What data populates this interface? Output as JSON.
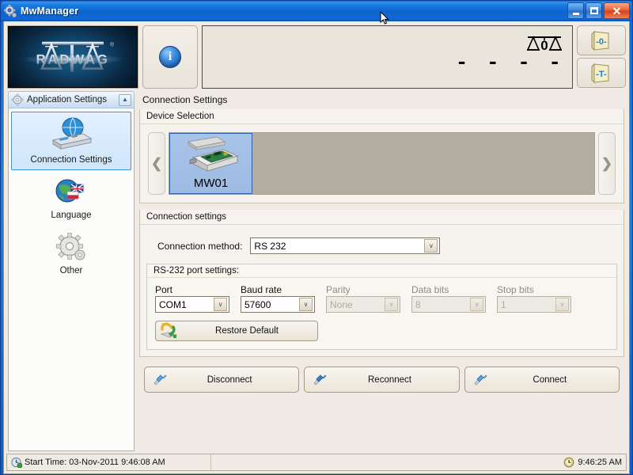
{
  "window": {
    "title": "MwManager",
    "icon": "gear-icon",
    "minimize_label": "Minimize",
    "maximize_label": "Maximize",
    "close_label": "Close"
  },
  "topbar": {
    "logo_text": "RADWAG",
    "logo_mark": "®",
    "info_glyph": "i",
    "display": {
      "weight_value": "- - - -",
      "stability_indicator": "0",
      "scale_icon": "balance-scale-icon"
    },
    "tool_buttons": [
      {
        "name": "zero-button",
        "icon": "zero-icon",
        "glyph": "-0-"
      },
      {
        "name": "tare-button",
        "icon": "tare-icon",
        "glyph": "-T-"
      }
    ]
  },
  "sidebar": {
    "header": "Application Settings",
    "header_icon": "gear-icon",
    "collapse_glyph": "▲",
    "items": [
      {
        "label": "Connection Settings",
        "icon": "network-device-icon",
        "active": true
      },
      {
        "label": "Language",
        "icon": "globe-flags-icon",
        "active": false
      },
      {
        "label": "Other",
        "icon": "gear-icon",
        "active": false
      }
    ]
  },
  "content": {
    "title": "Connection Settings",
    "device_selection": {
      "group_title": "Device Selection",
      "prev_glyph": "❮",
      "next_glyph": "❯",
      "devices": [
        {
          "name": "MW01",
          "icon": "circuit-board-module-icon",
          "selected": true
        }
      ]
    },
    "connection_settings": {
      "group_title": "Connection settings",
      "method_label": "Connection method:",
      "method_value": "RS 232",
      "dropdown_glyph": "∨",
      "port_settings": {
        "group_title": "RS-232 port settings:",
        "fields": [
          {
            "label": "Port",
            "value": "COM1",
            "disabled": false,
            "width": 94
          },
          {
            "label": "Baud rate",
            "value": "57600",
            "disabled": false,
            "width": 94
          },
          {
            "label": "Parity",
            "value": "None",
            "disabled": true,
            "width": 94
          },
          {
            "label": "Data bits",
            "value": "8",
            "disabled": true,
            "width": 94
          },
          {
            "label": "Stop bits",
            "value": "1",
            "disabled": true,
            "width": 94
          }
        ]
      },
      "restore_button": {
        "label": "Restore Default",
        "icon": "restore-refresh-icon"
      }
    }
  },
  "actions": [
    {
      "label": "Disconnect",
      "icon": "plug-icon"
    },
    {
      "label": "Reconnect",
      "icon": "plug-icon"
    },
    {
      "label": "Connect",
      "icon": "plug-icon"
    }
  ],
  "statusbar": {
    "start_time": "Start Time: 03-Nov-2011 9:46:08 AM",
    "start_icon": "clock-start-icon",
    "current_time": "9:46:25 AM",
    "clock_icon": "clock-icon"
  },
  "colors": {
    "title_blue": "#0d64cf",
    "accent_blue": "#2f62a8",
    "panel_bg": "#efebe4",
    "selected_device": "#9dbbe3",
    "track_bg": "#b2ada0"
  }
}
